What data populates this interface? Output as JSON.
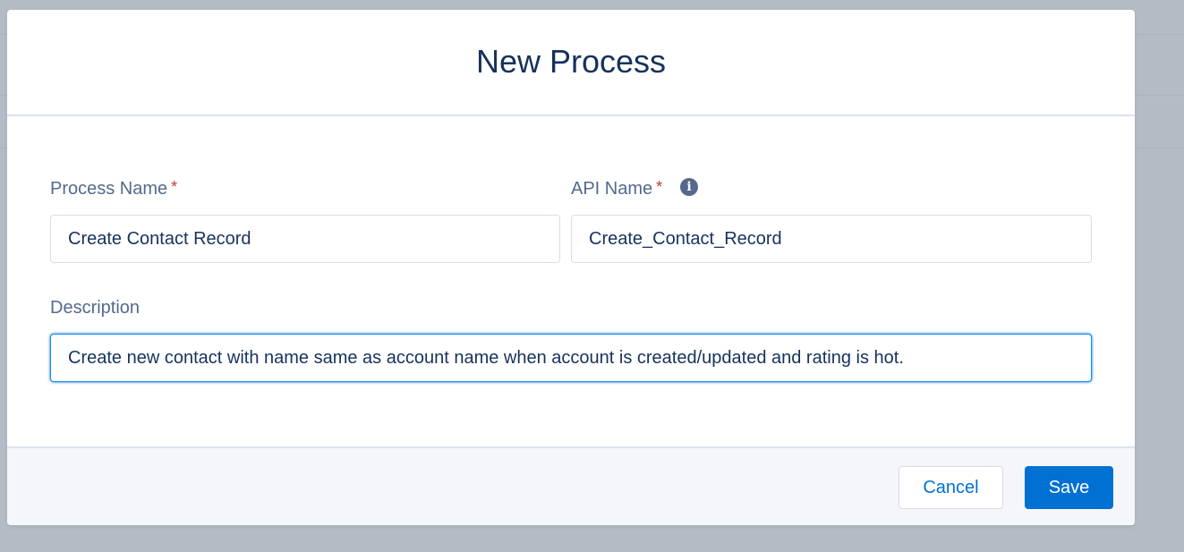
{
  "modal": {
    "title": "New Process"
  },
  "form": {
    "process_name": {
      "label": "Process Name",
      "required_marker": "*",
      "value": "Create Contact Record"
    },
    "api_name": {
      "label": "API Name",
      "required_marker": "*",
      "info_icon": "info-icon",
      "value": "Create_Contact_Record"
    },
    "description": {
      "label": "Description",
      "value": "Create new contact with name same as account name when account is created/updated and rating is hot."
    }
  },
  "footer": {
    "cancel_label": "Cancel",
    "save_label": "Save"
  },
  "colors": {
    "brand": "#0070d2",
    "title": "#16325c",
    "label": "#54698d",
    "required": "#c23934",
    "focus_border": "#1589ee"
  }
}
